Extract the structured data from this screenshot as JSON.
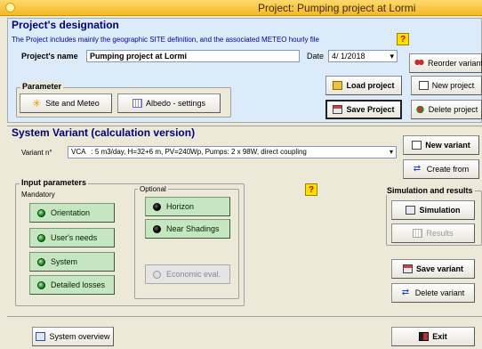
{
  "window": {
    "title": "Project:  Pumping project at Lormi"
  },
  "project": {
    "heading": "Project's designation",
    "description": "The Project includes mainly the geographic SITE definition, and the associated METEO  hourly file",
    "name_label": "Project's name",
    "name_value": "Pumping project at Lormi",
    "date_label": "Date",
    "date_value": "4/ 1/2018",
    "help": "?"
  },
  "parameter": {
    "title": "Parameter",
    "site_meteo": "Site and Meteo",
    "albedo": "Albedo - settings"
  },
  "project_buttons": {
    "reorder": "Reorder variants",
    "load": "Load project",
    "new": "New project",
    "save": "Save Project",
    "delete": "Delete project"
  },
  "variant": {
    "heading": "System Variant (calculation version)",
    "label": "Variant n°",
    "code": "VCA",
    "value": ": 5 m3/day, H=32+6 m, PV=240Wp, Pumps: 2 x 98W, direct coupling",
    "new": "New variant",
    "create_from": "Create from"
  },
  "inputs": {
    "title": "Input parameters",
    "mandatory_title": "Mandatory",
    "optional_title": "Optional",
    "orientation": "Orientation",
    "users_needs": "User's needs",
    "system": "System",
    "detailed_losses": "Detailed losses",
    "horizon": "Horizon",
    "near_shadings": "Near Shadings",
    "economic_eval": "Economic eval.",
    "help": "?"
  },
  "simulation": {
    "title": "Simulation and results",
    "simulation": "Simulation",
    "results": "Results"
  },
  "variant_actions": {
    "save": "Save variant",
    "delete": "Delete variant"
  },
  "footer": {
    "overview": "System overview",
    "exit": "Exit"
  },
  "colors": {
    "accent_title": "#00007a",
    "titlebar": "#f4b828",
    "project_bg": "#dcebfa",
    "green_btn": "#c5e6c0"
  }
}
